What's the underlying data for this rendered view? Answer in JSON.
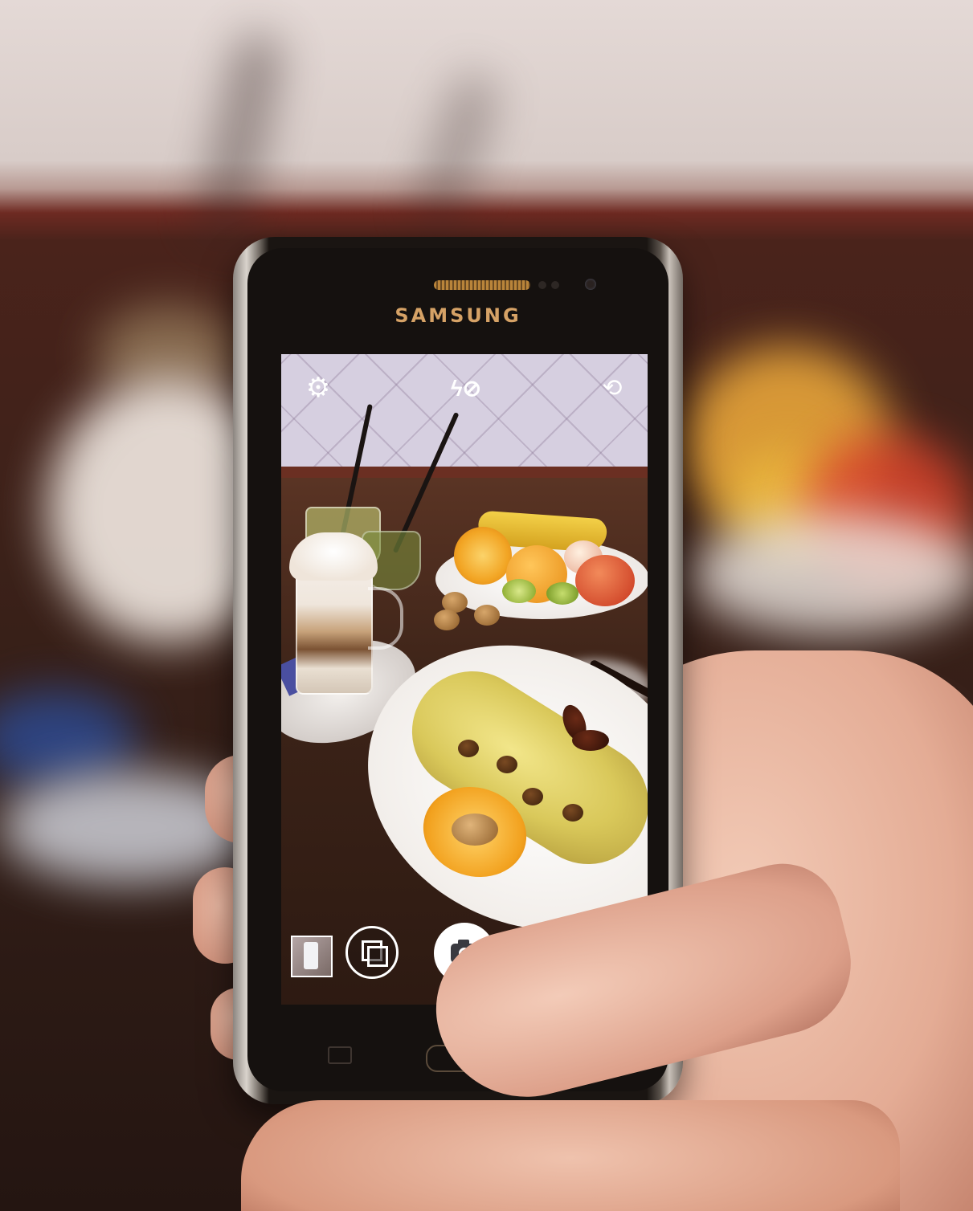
{
  "phone": {
    "brand": "SAMSUNG"
  },
  "camera_app": {
    "top_bar": {
      "settings_icon": "gear-icon",
      "flash_icon": "flash-off-icon",
      "switch_camera_icon": "switch-camera-icon",
      "settings_glyph": "⚙",
      "flash_glyph": "ϟ⊘",
      "switch_glyph": "⟲"
    },
    "bottom_bar": {
      "last_photo_thumbnail": "thumbnail",
      "gallery_icon": "gallery-icon",
      "shutter_icon": "camera-icon",
      "mode_icon": "video-icon"
    }
  },
  "colors": {
    "brand_text": "#d6a266",
    "ui_icons": "#ffffff"
  }
}
